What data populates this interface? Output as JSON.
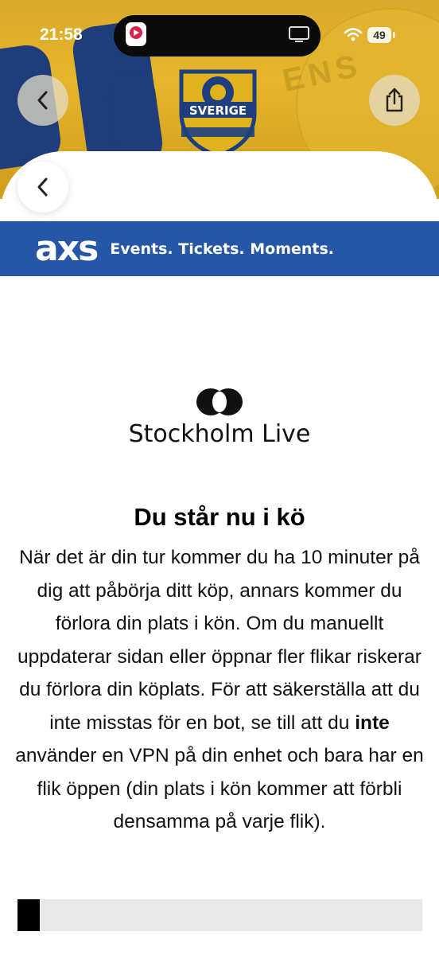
{
  "status_bar": {
    "time": "21:58",
    "battery": "49"
  },
  "hero": {
    "crest_text": "SVERIGE",
    "back_icon": "chevron-left-icon",
    "share_icon": "share-icon"
  },
  "sheet": {
    "back_icon": "chevron-left-icon"
  },
  "banner": {
    "logo": "axs",
    "tagline": "Events. Tickets. Moments.",
    "color": "#2656a6"
  },
  "organizer": {
    "name": "Stockholm Live"
  },
  "queue": {
    "title": "Du står nu i kö",
    "text_1": "När det är din tur kommer du ha 10 minuter på dig att påbörja ditt köp, annars kommer du förlora din plats i kön. Om du manuellt uppdaterar sidan eller öppnar fler flikar riskerar du förlora din köplats. För att säkerställa att du inte misstas för en bot, se till att du ",
    "text_bold": "inte",
    "text_2": " använder en VPN på din enhet och bara har en flik öppen (din plats i kön kommer att förbli densamma på varje flik).",
    "progress": 0.055
  }
}
